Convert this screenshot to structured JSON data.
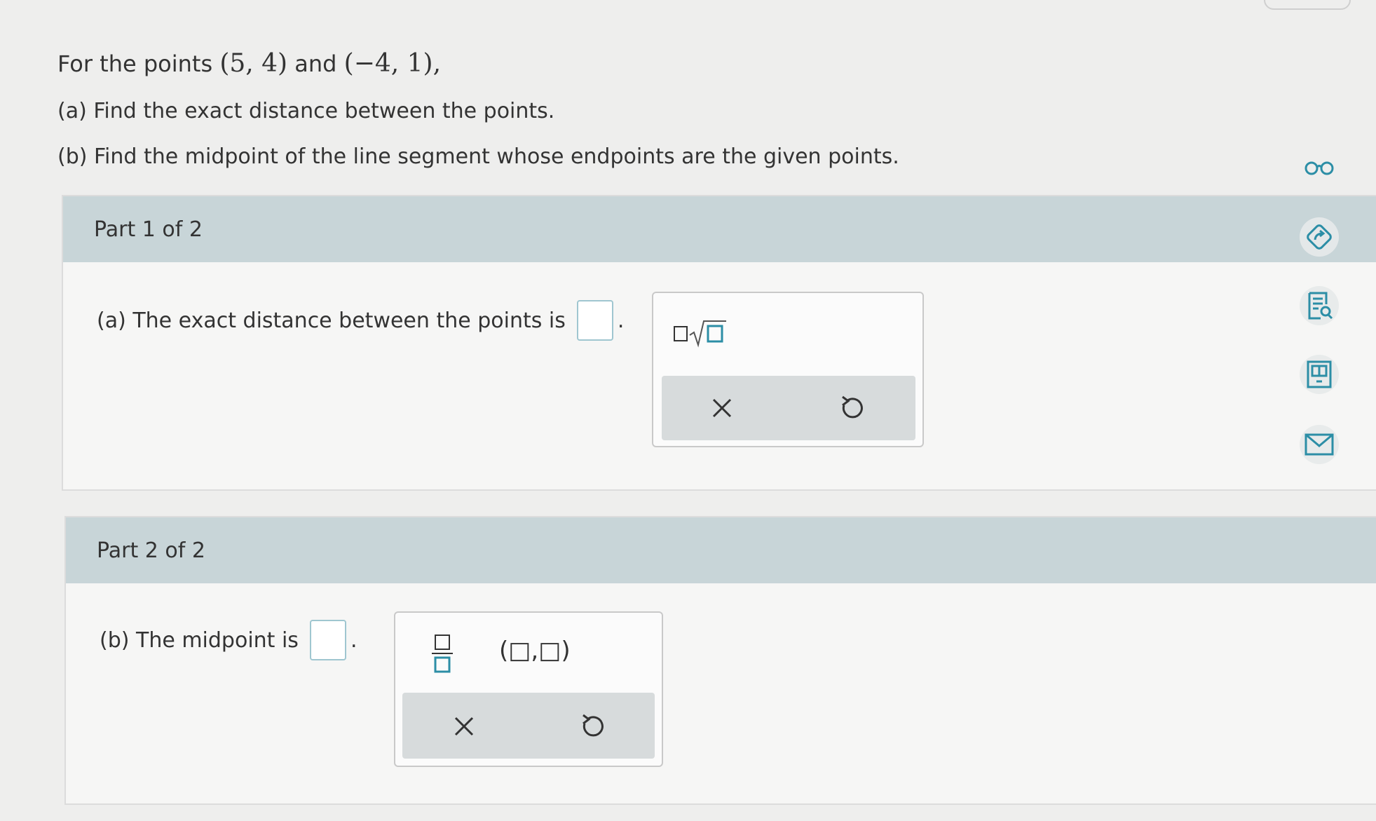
{
  "question": {
    "intro_prefix": "For the points",
    "point1": "(5, 4)",
    "and": "and",
    "point2": "(−4, 1),",
    "part_a": "(a) Find the exact distance between the points.",
    "part_b": "(b) Find the midpoint of the line segment whose endpoints are the given points."
  },
  "part1": {
    "header": "Part 1 of 2",
    "prompt": "(a) The exact distance between the points is",
    "period": "."
  },
  "part2": {
    "header": "Part 2 of 2",
    "prompt": "(b) The midpoint is",
    "period": "."
  },
  "palette1": {
    "tools": [
      "sqrt-template-icon"
    ],
    "actions": [
      "clear-icon",
      "undo-icon"
    ]
  },
  "palette2": {
    "tools": [
      "fraction-template-icon",
      "ordered-pair-template-icon"
    ],
    "ordered_pair_label": "(□,□)",
    "actions": [
      "clear-icon",
      "undo-icon"
    ]
  },
  "sidebar": {
    "icons": [
      "glasses-icon",
      "explanation-icon",
      "worksheet-icon",
      "book-icon",
      "mail-icon"
    ]
  },
  "colors": {
    "header_bg": "#c8d5d8",
    "answer_border": "#9fc6d0",
    "icon_color": "#2c8ea6"
  }
}
